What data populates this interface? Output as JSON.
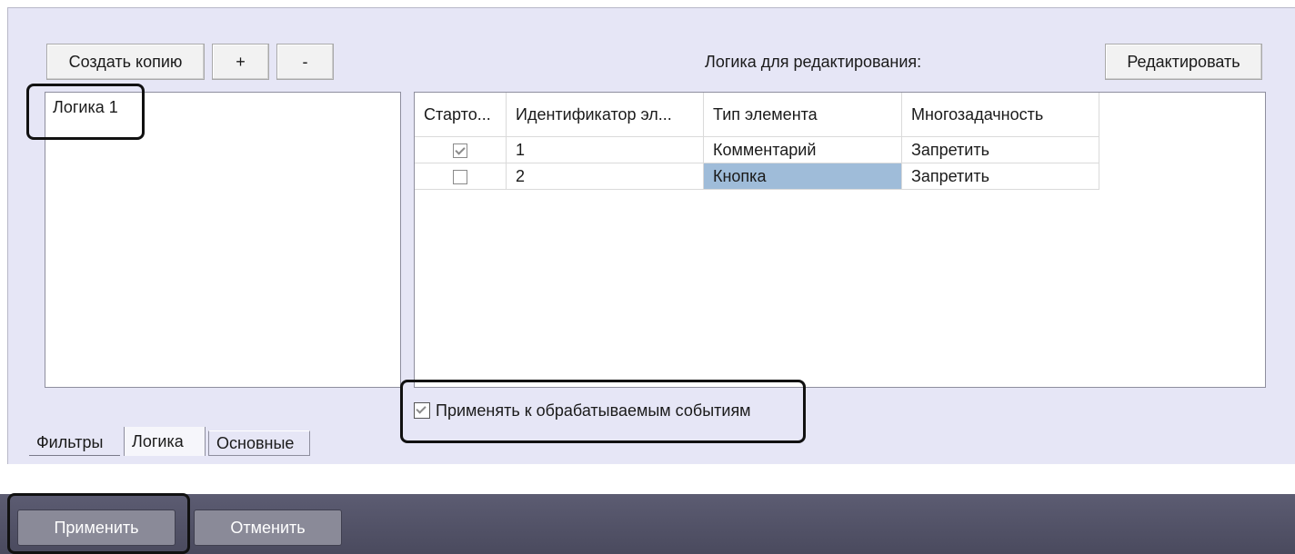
{
  "toolbar": {
    "copy_label": "Создать копию",
    "add_label": "+",
    "remove_label": "-",
    "logic_edit_label": "Логика для редактирования:",
    "edit_label": "Редактировать"
  },
  "logic_list": {
    "items": [
      "Логика 1"
    ]
  },
  "grid": {
    "headers": [
      "Старто...",
      "Идентификатор эл...",
      "Тип элемента",
      "Многозадачность"
    ],
    "rows": [
      {
        "start": true,
        "id": "1",
        "type": "Комментарий",
        "multitask": "Запретить"
      },
      {
        "start": false,
        "id": "2",
        "type": "Кнопка",
        "multitask": "Запретить"
      }
    ]
  },
  "apply_events": {
    "checked": true,
    "label": "Применять к обрабатываемым событиям"
  },
  "tabs": [
    "Фильтры",
    "Логика",
    "Основные"
  ],
  "footer": {
    "apply_label": "Применить",
    "cancel_label": "Отменить"
  }
}
